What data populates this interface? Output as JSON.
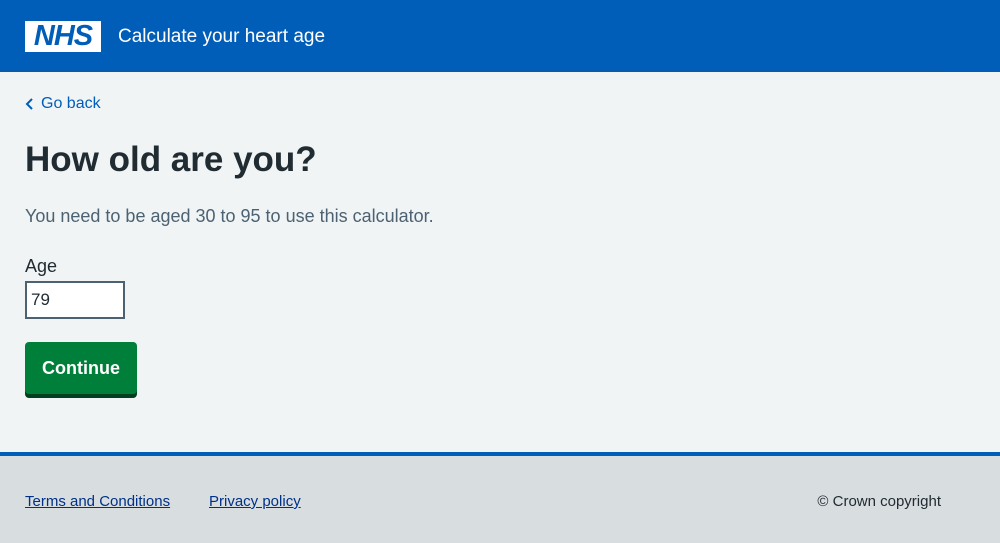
{
  "header": {
    "logo_text": "NHS",
    "service_name": "Calculate your heart age",
    "brand_color": "#005eb8"
  },
  "back_link": {
    "icon": "chevron-left-icon",
    "label": "Go back"
  },
  "main": {
    "title": "How old are you?",
    "hint": "You need to be aged 30 to 95 to use this calculator.",
    "age_label": "Age",
    "age_value": "79",
    "continue_label": "Continue",
    "button_color": "#007f3b"
  },
  "footer": {
    "links": [
      "Terms and Conditions",
      "Privacy policy"
    ],
    "copyright": "© Crown copyright"
  }
}
